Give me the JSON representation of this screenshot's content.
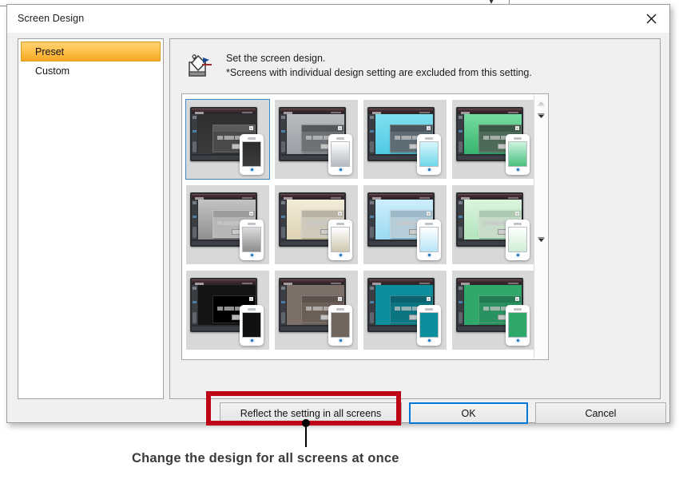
{
  "window": {
    "title": "Screen Design",
    "close_icon": "close-icon"
  },
  "sidebar": {
    "items": [
      {
        "label": "Preset",
        "selected": true
      },
      {
        "label": "Custom",
        "selected": false
      }
    ]
  },
  "info": {
    "icon": "paint-bucket-icon",
    "line1": "Set the screen design.",
    "line2": "*Screens with individual design setting are excluded from this setting."
  },
  "thumbnails": {
    "selected_index": 0,
    "items": [
      {
        "name": "design-dark-charcoal",
        "screen": "#2e2e2e",
        "screen2": "#3b3b3b",
        "dialog": "#4a4a4a",
        "dialog_title": "#5a5a5a",
        "phone": "#2b2b2b",
        "phone2": "#3d3d3d",
        "selected": true
      },
      {
        "name": "design-silver-gray",
        "screen": "#b8bcc0",
        "screen2": "#9aa0a6",
        "dialog": "#6e7277",
        "dialog_title": "#55585c",
        "phone": "#ffffff",
        "phone2": "#b4bac0",
        "selected": false
      },
      {
        "name": "design-sky-cyan",
        "screen": "#7fe0ef",
        "screen2": "#4fc9e3",
        "dialog": "#5c6b74",
        "dialog_title": "#49565e",
        "phone": "#d8f6fb",
        "phone2": "#6fd8ea",
        "selected": false
      },
      {
        "name": "design-emerald-green",
        "screen": "#76dca0",
        "screen2": "#37b46f",
        "dialog": "#4d6a58",
        "dialog_title": "#3c5647",
        "phone": "#cdf3dd",
        "phone2": "#49c07e",
        "selected": false
      },
      {
        "name": "design-neutral-gray",
        "screen": "#c3c3c3",
        "screen2": "#8f8f8f",
        "dialog": "#b6b6b6",
        "dialog_title": "#9c9c9c",
        "phone": "#dcdcdc",
        "phone2": "#8c8c8c",
        "selected": false
      },
      {
        "name": "design-cream-beige",
        "screen": "#f3ecd9",
        "screen2": "#ded2b4",
        "dialog": "#cfc9bb",
        "dialog_title": "#b9b2a2",
        "phone": "#ffffff",
        "phone2": "#cfc6ae",
        "selected": false
      },
      {
        "name": "design-pale-blue",
        "screen": "#cdeefb",
        "screen2": "#9ad9f3",
        "dialog": "#b5cdd9",
        "dialog_title": "#9db8c6",
        "phone": "#ffffff",
        "phone2": "#b7e4f6",
        "selected": false
      },
      {
        "name": "design-pale-green",
        "screen": "#dcf4dd",
        "screen2": "#b2e4bc",
        "dialog": "#c6dcc8",
        "dialog_title": "#aec9b2",
        "phone": "#ffffff",
        "phone2": "#cdeed4",
        "selected": false
      },
      {
        "name": "design-black",
        "screen": "#141414",
        "screen2": "#141414",
        "dialog": "#000000",
        "dialog_title": "#000000",
        "phone": "#111111",
        "phone2": "#111111",
        "selected": false
      },
      {
        "name": "design-warm-brown",
        "screen": "#7d7068",
        "screen2": "#7d7068",
        "dialog": "#6b5f58",
        "dialog_title": "#5d524c",
        "phone": "#72655e",
        "phone2": "#72655e",
        "selected": false
      },
      {
        "name": "design-teal",
        "screen": "#0d8e9c",
        "screen2": "#0d8e9c",
        "dialog": "#0b7682",
        "dialog_title": "#0a636e",
        "phone": "#0d8e9c",
        "phone2": "#0d8e9c",
        "selected": false
      },
      {
        "name": "design-jade-green",
        "screen": "#31a86b",
        "screen2": "#31a86b",
        "dialog": "#2a9260",
        "dialog_title": "#237c51",
        "phone": "#31a86b",
        "phone2": "#31a86b",
        "selected": false
      }
    ]
  },
  "scrollbar": {
    "up_arrow_icon": "scroll-up-arrow-icon",
    "down_arrow_icon": "scroll-down-arrow-icon"
  },
  "buttons": {
    "reflect": "Reflect the setting in all screens",
    "ok": "OK",
    "cancel": "Cancel"
  },
  "annotation": {
    "caption": "Change the design for all screens at once",
    "highlight_color": "#c00418"
  }
}
